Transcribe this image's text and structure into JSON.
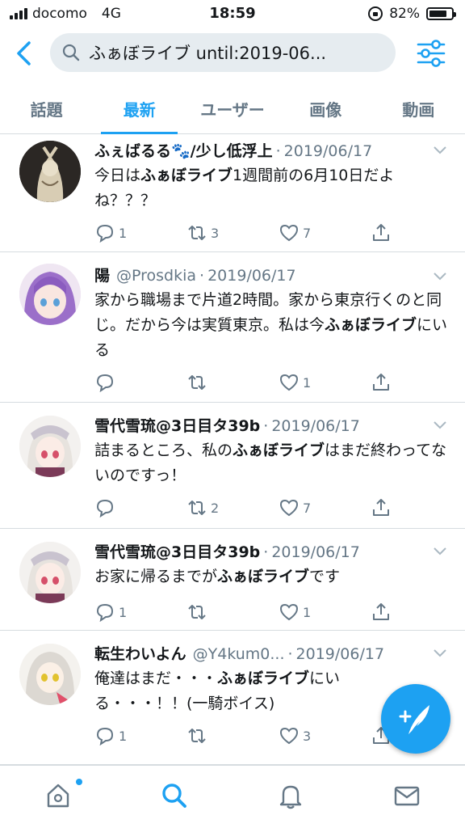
{
  "status_bar": {
    "carrier": "docomo",
    "network": "4G",
    "time": "18:59",
    "battery": "82%",
    "battery_level": 0.82
  },
  "search": {
    "query": "ふぁぼライブ until:2019-06..."
  },
  "tabs": [
    {
      "label": "話題",
      "active": false
    },
    {
      "label": "最新",
      "active": true
    },
    {
      "label": "ユーザー",
      "active": false
    },
    {
      "label": "画像",
      "active": false
    },
    {
      "label": "動画",
      "active": false
    }
  ],
  "tweets": [
    {
      "name": "ふぇばるる🐾/少し低浮上",
      "handle": "",
      "date": "2019/06/17",
      "body_1": "今日は",
      "body_2": "ふぁぼライブ",
      "body_3": "1週間前の6月10日だよね？？？",
      "reply": "1",
      "retweet": "3",
      "like": "7"
    },
    {
      "name": "陽",
      "handle": "@Prosdkia",
      "date": "2019/06/17",
      "body_1": "家から職場まで片道2時間。家から東京行くのと同じ。だから今は実質東京。私は今",
      "body_2": "ふぁぼライブ",
      "body_3": "にいる",
      "reply": "",
      "retweet": "",
      "like": "1"
    },
    {
      "name": "雪代雪琉@3日目タ39b",
      "handle": "",
      "date": "2019/06/17",
      "body_1": "詰まるところ、私の",
      "body_2": "ふぁぼライブ",
      "body_3": "はまだ終わってないのですっ！",
      "reply": "",
      "retweet": "2",
      "like": "7"
    },
    {
      "name": "雪代雪琉@3日目タ39b",
      "handle": "",
      "date": "2019/06/17",
      "body_1": "お家に帰るまでが",
      "body_2": "ふぁぼライブ",
      "body_3": "です",
      "reply": "1",
      "retweet": "",
      "like": "1"
    },
    {
      "name": "転生わいよん",
      "handle": "@Y4kum0...",
      "date": "2019/06/17",
      "body_1": "俺達はまだ・・・",
      "body_2": "ふぁぼライブ",
      "body_3": "にいる・・・！！(一騎ボイス)",
      "reply": "1",
      "retweet": "",
      "like": "3"
    }
  ],
  "colors": {
    "accent": "#1da1f2",
    "text": "#14171a",
    "muted": "#657786",
    "search_bg": "#e6ecf0"
  }
}
